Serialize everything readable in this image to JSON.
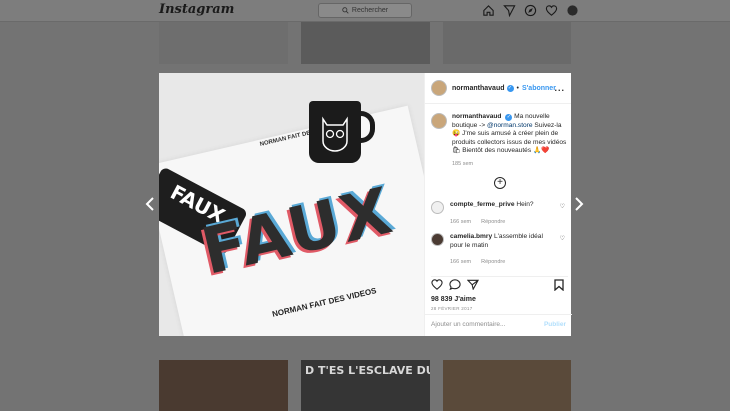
{
  "app": {
    "logo": "Instagram",
    "search_placeholder": "Rechercher"
  },
  "nav_icons": [
    "home-icon",
    "direct-icon",
    "explore-icon",
    "heart-icon",
    "profile-icon"
  ],
  "background": {
    "bottom_thumb_text": "D T'ES L'ESCLAVE DU CONDUC"
  },
  "post": {
    "username": "normanthavaud",
    "follow_label": "S'abonner",
    "more_label": "...",
    "caption_username": "normanthavaud",
    "caption_line1": "Ma nouvelle boutique ->",
    "caption_mention": "@norman.store",
    "caption_line2": "Suivez-la 😜 J'me suis amusé à créer plein de produits collectors issus de mes vidéos 🛍 Bientôt des nouveautés 🙏❤️",
    "caption_time": "185 sem",
    "photo": {
      "big_text": "FAUX",
      "phone_text": "FAUX",
      "shirt_tagline": "NORMAN FAIT DES VIDEOS",
      "shirt_logo": "NORMAN FAIT DES VIDEOS"
    },
    "comments": [
      {
        "username": "compte_ferme_prive",
        "text": "Hein?",
        "time": "166 sem",
        "reply": "Répondre"
      },
      {
        "username": "camelia.bmry",
        "text": "L'assemble idéal pour le matin",
        "time": "166 sem",
        "reply": "Répondre"
      }
    ],
    "likes": "98 839 J'aime",
    "date": "28 FÉVRIER 2017",
    "add_comment_placeholder": "Ajouter un commentaire...",
    "publish_label": "Publier"
  },
  "colors": {
    "accent": "#3897f0",
    "overlay": "#737373"
  }
}
